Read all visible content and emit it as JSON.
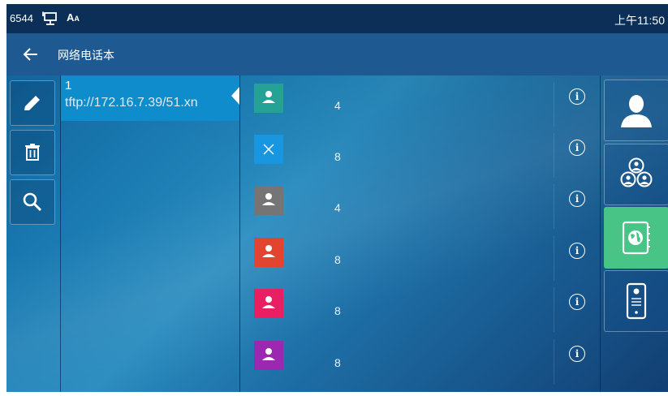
{
  "statusbar": {
    "extension": "6544",
    "font_icon_text": "A",
    "time": "上午11:50"
  },
  "titlebar": {
    "title": "网络电话本"
  },
  "toolbar": {
    "edit": {
      "icon": "pencil-icon"
    },
    "delete": {
      "icon": "trash-icon"
    },
    "search": {
      "icon": "search-icon"
    }
  },
  "groups": [
    {
      "number": "1",
      "url": "tftp://172.16.7.39/51.xn",
      "selected": true
    }
  ],
  "contacts": [
    {
      "name": "4",
      "avatar_type": "person",
      "color": "#26a196"
    },
    {
      "name": "8",
      "avatar_type": "x",
      "color": "#1896e0"
    },
    {
      "name": "4",
      "avatar_type": "person",
      "color": "#757575"
    },
    {
      "name": "8",
      "avatar_type": "person",
      "color": "#e2442f"
    },
    {
      "name": "8",
      "avatar_type": "person",
      "color": "#e91e63"
    },
    {
      "name": "8",
      "avatar_type": "person",
      "color": "#9c27b0"
    }
  ],
  "info_icon": "i",
  "nav": [
    {
      "name": "local-directory",
      "icon": "person-icon",
      "active": false
    },
    {
      "name": "blacklist-groups",
      "icon": "group-icon",
      "active": false
    },
    {
      "name": "remote-phonebook",
      "icon": "globe-book-icon",
      "active": true,
      "color": "#48c486"
    },
    {
      "name": "door-phone",
      "icon": "intercom-icon",
      "active": false
    }
  ]
}
